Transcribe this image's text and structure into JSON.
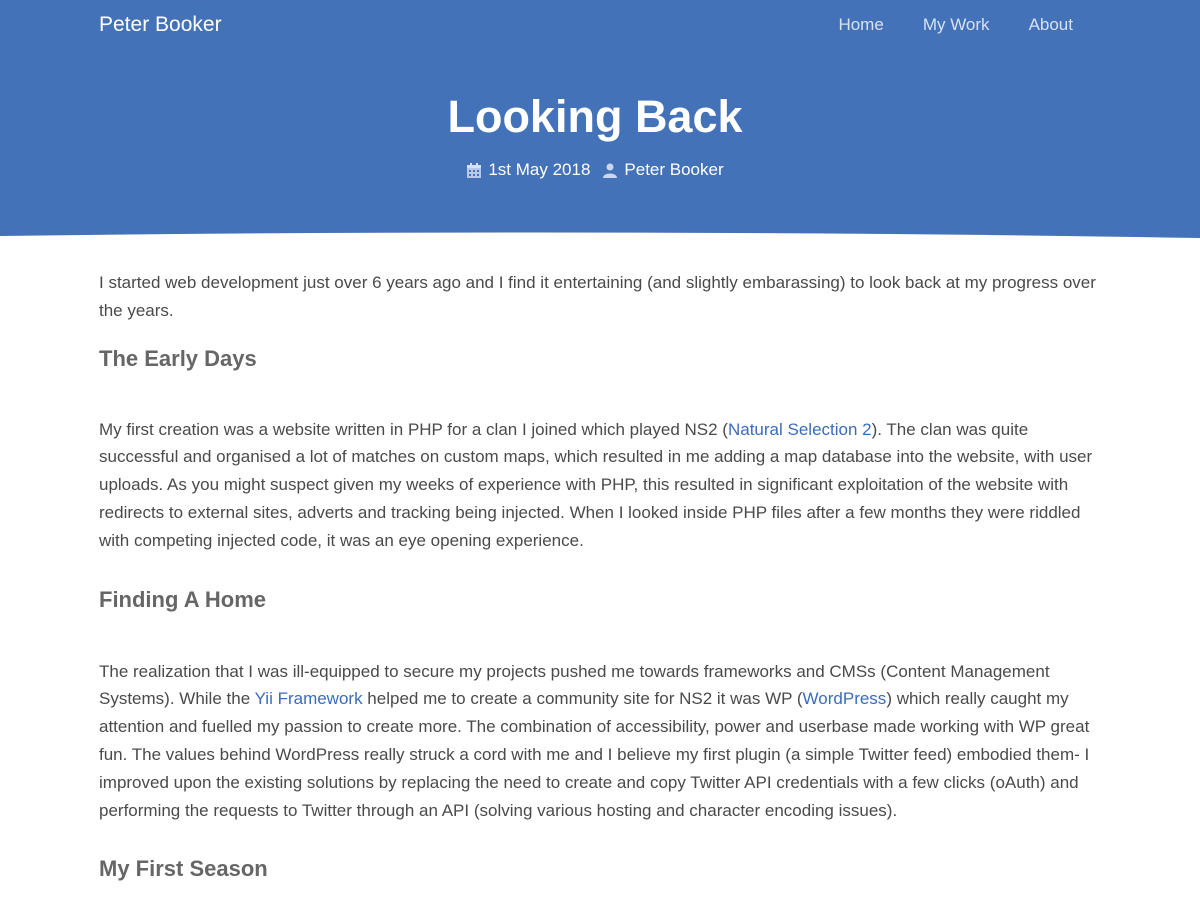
{
  "header": {
    "site_title": "Peter Booker",
    "nav": [
      "Home",
      "My Work",
      "About"
    ]
  },
  "post": {
    "title": "Looking Back",
    "date": "1st May 2018",
    "author": "Peter Booker"
  },
  "icons": {
    "date": "calendar-icon",
    "author": "user-icon"
  },
  "content": {
    "intro": "I started web development just over 6 years ago and I find it entertaining (and slightly embarassing) to look back at my progress over the years.",
    "section1": {
      "heading": "The Early Days",
      "text_before_link": "My first creation was a website written in PHP for a clan I joined which played NS2 (",
      "link": "Natural Selection 2",
      "text_after_link": "). The clan was quite successful and organised a lot of matches on custom maps, which resulted in me adding a map database into the website, with user uploads. As you might suspect given my weeks of experience with PHP, this resulted in significant exploitation of the website with redirects to external sites, adverts and tracking being injected. When I looked inside PHP files after a few months they were riddled with competing injected code, it was an eye opening experience."
    },
    "section2": {
      "heading": "Finding A Home",
      "text_1": "The realization that I was ill-equipped to secure my projects pushed me towards frameworks and CMSs (Content Management Systems). While the ",
      "link_1": "Yii Framework",
      "text_2": " helped me to create a community site for NS2 it was WP (",
      "link_2": "WordPress",
      "text_3": ") which really caught my attention and fuelled my passion to create more. The combination of accessibility, power and userbase made working with WP great fun. The values behind WordPress really struck a cord with me and I believe my first plugin (a simple Twitter feed) embodied them- I improved upon the existing solutions by replacing the need to create and copy Twitter API credentials with a few clicks (oAuth) and performing the requests to Twitter through an API (solving various hosting and character encoding issues)."
    },
    "section3": {
      "heading": "My First Season"
    }
  },
  "colors": {
    "header_bg": "#4472b8",
    "link": "#3b6cb9",
    "body_text": "#4a4a4a",
    "heading_text": "#666666"
  }
}
